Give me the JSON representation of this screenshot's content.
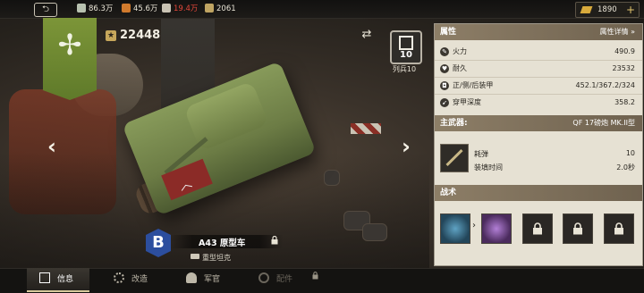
{
  "topbar": {
    "resources": [
      {
        "icon": "silver-coin-icon",
        "value": "86.3万",
        "color": "#e9e4d6"
      },
      {
        "icon": "supplies-icon",
        "value": "45.6万",
        "color": "#e9e4d6"
      },
      {
        "icon": "steel-icon",
        "value": "19.4万",
        "color": "#e3473a"
      },
      {
        "icon": "ammo-icon",
        "value": "2061",
        "color": "#e9e4d6"
      }
    ],
    "gold": "1890"
  },
  "vehicle": {
    "battle_points": "22448",
    "tier": "10",
    "tier_label": "列兵10",
    "name": "A43 原型车",
    "class": "重型坦克",
    "badge": "B"
  },
  "panel": {
    "attributes_title": "属性",
    "attributes_detail_link": "属性详情",
    "attributes": [
      {
        "icon": "firepower-icon",
        "label": "火力",
        "value": "490.9"
      },
      {
        "icon": "durability-icon",
        "label": "耐久",
        "value": "23532"
      },
      {
        "icon": "armor-icon",
        "label": "正/侧/后装甲",
        "value": "452.1/367.2/324"
      },
      {
        "icon": "penetration-icon",
        "label": "穿甲深度",
        "value": "358.2"
      }
    ],
    "main_weapon_title": "主武器:",
    "main_weapon_name": "QF 17磅炮 MK.II型",
    "weapon_stats": [
      {
        "label": "耗弹",
        "value": "10"
      },
      {
        "label": "装填时间",
        "value": "2.0秒"
      }
    ],
    "tactics_title": "战术"
  },
  "tabs": [
    {
      "label": "信息",
      "icon": "info-icon",
      "active": true
    },
    {
      "label": "改造",
      "icon": "gear-icon",
      "active": false
    },
    {
      "label": "军官",
      "icon": "officer-icon",
      "active": false
    },
    {
      "label": "配件",
      "icon": "parts-icon",
      "active": false,
      "locked": true
    }
  ]
}
